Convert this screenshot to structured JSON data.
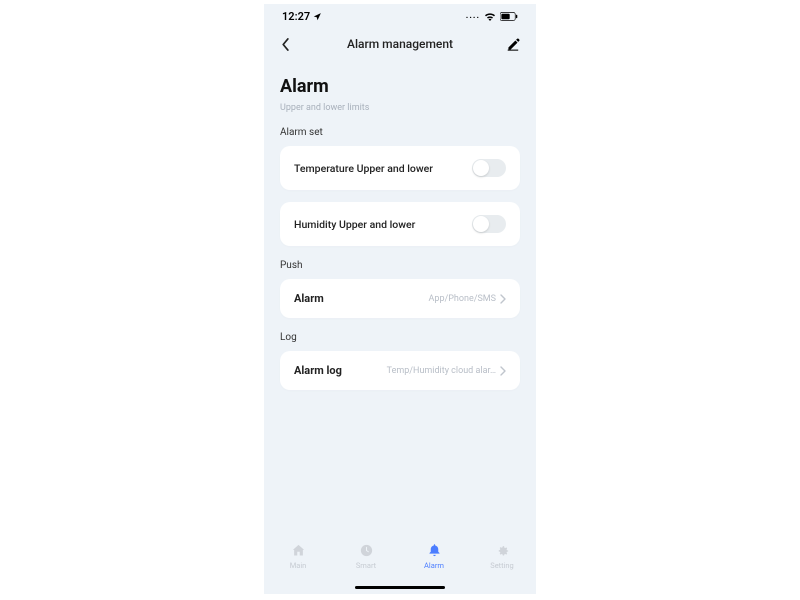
{
  "status": {
    "time": "12:27",
    "dots": "...."
  },
  "header": {
    "title": "Alarm management"
  },
  "page": {
    "title": "Alarm",
    "subtitle": "Upper and lower limits"
  },
  "sections": {
    "alarm_set": {
      "label": "Alarm set",
      "temperature": "Temperature Upper and lower",
      "humidity": "Humidity Upper and lower"
    },
    "push": {
      "label": "Push",
      "alarm_label": "Alarm",
      "alarm_value": "App/Phone/SMS"
    },
    "log": {
      "label": "Log",
      "log_label": "Alarm log",
      "log_value": "Temp/Humidity cloud alar…"
    }
  },
  "tabbar": {
    "main": "Main",
    "smart": "Smart",
    "alarm": "Alarm",
    "setting": "Setting"
  }
}
